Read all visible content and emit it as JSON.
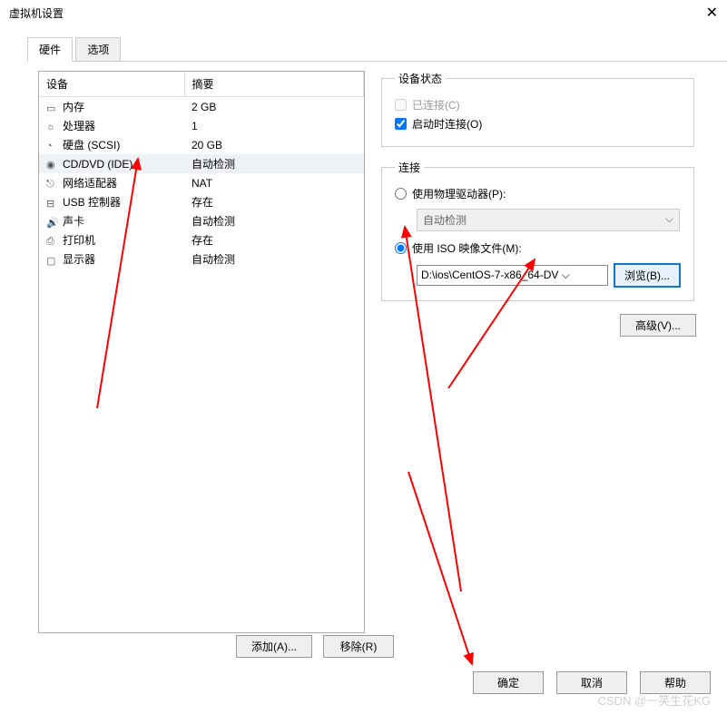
{
  "window": {
    "title": "虚拟机设置"
  },
  "tabs": {
    "hardware": "硬件",
    "options": "选项"
  },
  "table": {
    "headers": {
      "device": "设备",
      "summary": "摘要"
    },
    "rows": [
      {
        "name": "内存",
        "summary": "2 GB"
      },
      {
        "name": "处理器",
        "summary": "1"
      },
      {
        "name": "硬盘 (SCSI)",
        "summary": "20 GB"
      },
      {
        "name": "CD/DVD (IDE)",
        "summary": "自动检测"
      },
      {
        "name": "网络适配器",
        "summary": "NAT"
      },
      {
        "name": "USB 控制器",
        "summary": "存在"
      },
      {
        "name": "声卡",
        "summary": "自动检测"
      },
      {
        "name": "打印机",
        "summary": "存在"
      },
      {
        "name": "显示器",
        "summary": "自动检测"
      }
    ]
  },
  "status": {
    "legend": "设备状态",
    "connected": "已连接(C)",
    "connectAtPowerOn": "启动时连接(O)"
  },
  "connection": {
    "legend": "连接",
    "physical": "使用物理驱动器(P):",
    "autoDetect": "自动检测",
    "isoLabel": "使用 ISO 映像文件(M):",
    "isoPath": "D:\\ios\\CentOS-7-x86_64-DV",
    "browse": "浏览(B)..."
  },
  "buttons": {
    "advanced": "高级(V)...",
    "add": "添加(A)...",
    "remove": "移除(R)",
    "ok": "确定",
    "cancel": "取消",
    "help": "帮助"
  },
  "watermark": "CSDN @一笑生花KG"
}
